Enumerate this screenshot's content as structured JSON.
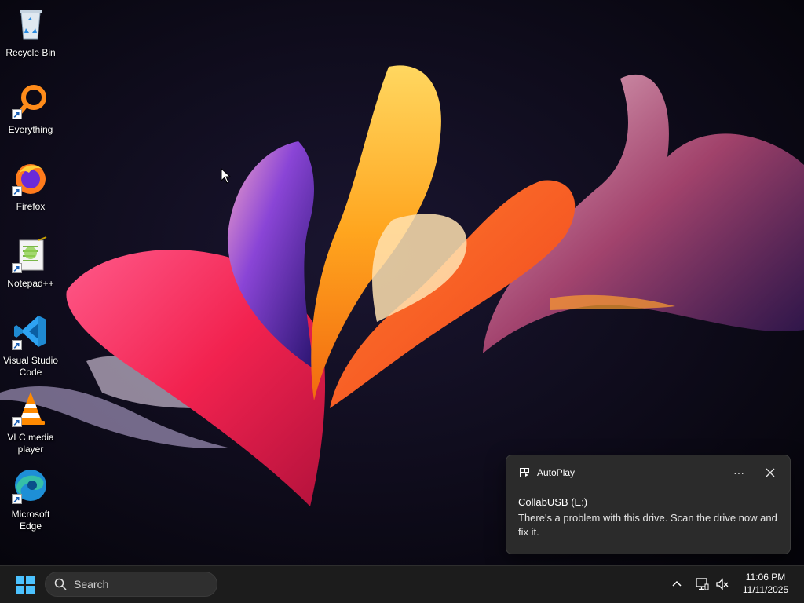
{
  "desktop": {
    "icons": [
      {
        "label": "Recycle Bin",
        "icon": "recycle-bin-icon",
        "shortcut": false
      },
      {
        "label": "Everything",
        "icon": "everything-search-icon",
        "shortcut": true
      },
      {
        "label": "Firefox",
        "icon": "firefox-icon",
        "shortcut": true
      },
      {
        "label": "Notepad++",
        "icon": "notepad-plus-plus-icon",
        "shortcut": true
      },
      {
        "label": "Visual Studio Code",
        "icon": "vscode-icon",
        "shortcut": true
      },
      {
        "label": "VLC media player",
        "icon": "vlc-icon",
        "shortcut": true
      },
      {
        "label": "Microsoft Edge",
        "icon": "edge-icon",
        "shortcut": true
      }
    ]
  },
  "notification": {
    "app_name": "AutoPlay",
    "more_label": "···",
    "title": "CollabUSB (E:)",
    "body": "There's a problem with this drive.  Scan the drive now and fix it."
  },
  "taskbar": {
    "search_placeholder": "Search",
    "time": "11:06 PM",
    "date": "11/11/2025"
  },
  "colors": {
    "taskbar_bg": "#1c1c1c",
    "toast_bg": "#2b2b2b",
    "accent_blue": "#0078d4"
  }
}
